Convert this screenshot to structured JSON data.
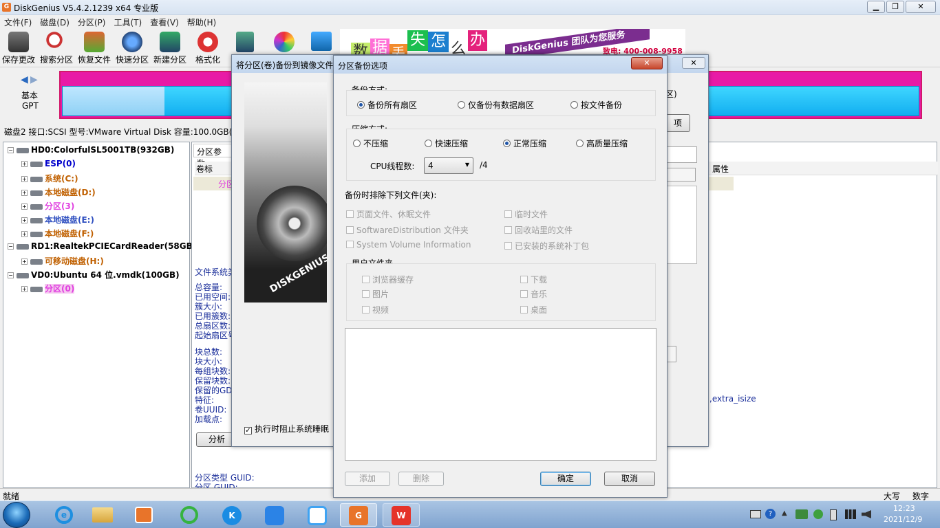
{
  "app": {
    "title": "DiskGenius V5.4.2.1239 x64 专业版"
  },
  "menu": [
    "文件(F)",
    "磁盘(D)",
    "分区(P)",
    "工具(T)",
    "查看(V)",
    "帮助(H)"
  ],
  "toolbar": [
    "保存更改",
    "搜索分区",
    "恢复文件",
    "快速分区",
    "新建分区",
    "格式化"
  ],
  "banner": {
    "chars": [
      "数",
      "据",
      "丢",
      "失",
      "怎",
      "么",
      "办"
    ],
    "slogan": "DiskGenius 团队为您服务",
    "phone": "致电: 400-008-9958"
  },
  "diskmap": {
    "label1": "基本",
    "label2": "GPT"
  },
  "diskinfo": "磁盘2 接口:SCSI  型号:VMware Virtual Disk  容量:100.0GB(",
  "tree": [
    {
      "text": "HD0:ColorfulSL5001TB(932GB)",
      "color": "#000000",
      "level": 0
    },
    {
      "text": "ESP(0)",
      "color": "#0000cc",
      "level": 1
    },
    {
      "text": "系统(C:)",
      "color": "#c06000",
      "level": 1
    },
    {
      "text": "本地磁盘(D:)",
      "color": "#c06000",
      "level": 1
    },
    {
      "text": "分区(3)",
      "color": "#e040e0",
      "level": 1
    },
    {
      "text": "本地磁盘(E:)",
      "color": "#3050c0",
      "level": 1
    },
    {
      "text": "本地磁盘(F:)",
      "color": "#c06000",
      "level": 1
    },
    {
      "text": "RD1:RealtekPCIECardReader(58GB)",
      "color": "#000000",
      "level": 0
    },
    {
      "text": "可移动磁盘(H:)",
      "color": "#c06000",
      "level": 1
    },
    {
      "text": "VD0:Ubuntu 64 位.vmdk(100GB)",
      "color": "#000000",
      "level": 0
    },
    {
      "text": "分区(0)",
      "color": "#e040e0",
      "level": 1
    }
  ],
  "rightpane": {
    "tab": "分区参数",
    "col_label": "卷标",
    "col_attr": "属性",
    "row1": "分区",
    "fs_heading": "文件系统类",
    "fields": [
      "总容量:",
      "已用空间:",
      "簇大小:",
      "已用簇数:",
      "总扇区数:",
      "起始扇区号"
    ],
    "fields2": [
      "块总数:",
      "块大小:",
      "每组块数:",
      "保留块数:",
      "保留的GD",
      "特征:",
      "卷UUID:",
      "加载点:"
    ],
    "analyze_btn": "分析",
    "extra_isize": ",extra_isize",
    "parttype": "分区类型 GUID:",
    "partguid": "分区 GUID:"
  },
  "backdlg": {
    "title": "将分区(卷)备份到镜像文件",
    "right_label": "区)",
    "right_btn": "项",
    "prevent_sleep": "执行时阻止系统睡眠",
    "logo_text": "DISKGENIUS"
  },
  "dlg": {
    "title": "分区备份选项",
    "backup_method": {
      "label": "备份方式:",
      "options": [
        "备份所有扇区",
        "仅备份有数据扇区",
        "按文件备份"
      ],
      "selected": 0
    },
    "compression": {
      "label": "压缩方式:",
      "options": [
        "不压缩",
        "快速压缩",
        "正常压缩",
        "高质量压缩"
      ],
      "selected": 2
    },
    "cpu": {
      "label": "CPU线程数:",
      "value": "4",
      "total": "/4"
    },
    "exclude": {
      "label": "备份时排除下列文件(夹):",
      "items": [
        "页面文件、休眠文件",
        "临时文件",
        "SoftwareDistribution 文件夹",
        "回收站里的文件",
        "System Volume Information",
        "已安装的系统补丁包"
      ]
    },
    "user_folders": {
      "label": "用户文件夹",
      "items": [
        "浏览器缓存",
        "下载",
        "图片",
        "音乐",
        "视频",
        "桌面"
      ]
    },
    "buttons": {
      "add": "添加",
      "delete": "删除",
      "ok": "确定",
      "cancel": "取消"
    }
  },
  "status": {
    "text": "就绪",
    "caps": "大写",
    "num": "数字"
  },
  "clock": {
    "time": "12:23",
    "date": "2021/12/9"
  }
}
